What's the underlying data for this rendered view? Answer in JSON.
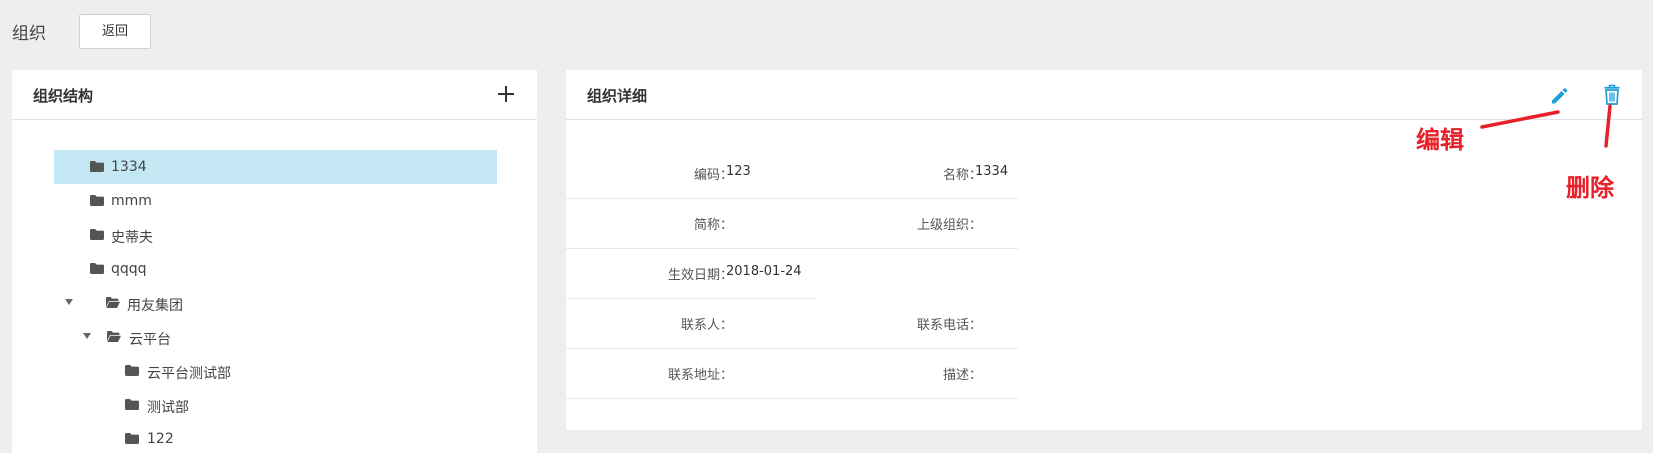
{
  "header": {
    "title": "组织",
    "back_label": "返回"
  },
  "tree_panel": {
    "title": "组织结构",
    "add_icon": "plus-icon",
    "items": [
      {
        "label": "1334",
        "level": 0,
        "expanded": false,
        "selected": true
      },
      {
        "label": "mmm",
        "level": 0,
        "expanded": false,
        "selected": false
      },
      {
        "label": "史蒂夫",
        "level": 0,
        "expanded": false,
        "selected": false
      },
      {
        "label": "qqqq",
        "level": 0,
        "expanded": false,
        "selected": false
      },
      {
        "label": "用友集团",
        "level": 0,
        "expanded": true,
        "selected": false
      },
      {
        "label": "云平台",
        "level": 1,
        "expanded": true,
        "selected": false
      },
      {
        "label": "云平台测试部",
        "level": 2,
        "expanded": false,
        "selected": false
      },
      {
        "label": "测试部",
        "level": 2,
        "expanded": false,
        "selected": false
      },
      {
        "label": "122",
        "level": 2,
        "expanded": false,
        "selected": false
      }
    ]
  },
  "detail_panel": {
    "title": "组织详细",
    "fields": {
      "code": {
        "label": "编码：",
        "value": "123"
      },
      "name": {
        "label": "名称：",
        "value": "1334"
      },
      "short_name": {
        "label": "简称：",
        "value": ""
      },
      "parent_org": {
        "label": "上级组织：",
        "value": ""
      },
      "effective_date": {
        "label": "生效日期：",
        "value": "2018-01-24"
      },
      "contact": {
        "label": "联系人：",
        "value": ""
      },
      "contact_phone": {
        "label": "联系电话：",
        "value": ""
      },
      "address": {
        "label": "联系地址：",
        "value": ""
      },
      "description": {
        "label": "描述：",
        "value": ""
      }
    }
  },
  "annotations": {
    "edit": "编辑",
    "delete": "删除"
  },
  "colors": {
    "background": "#edeef0",
    "selected_row": "#c3e8f3",
    "action_icon": "#1e9fd8",
    "annotation_red": "#e8202a"
  }
}
